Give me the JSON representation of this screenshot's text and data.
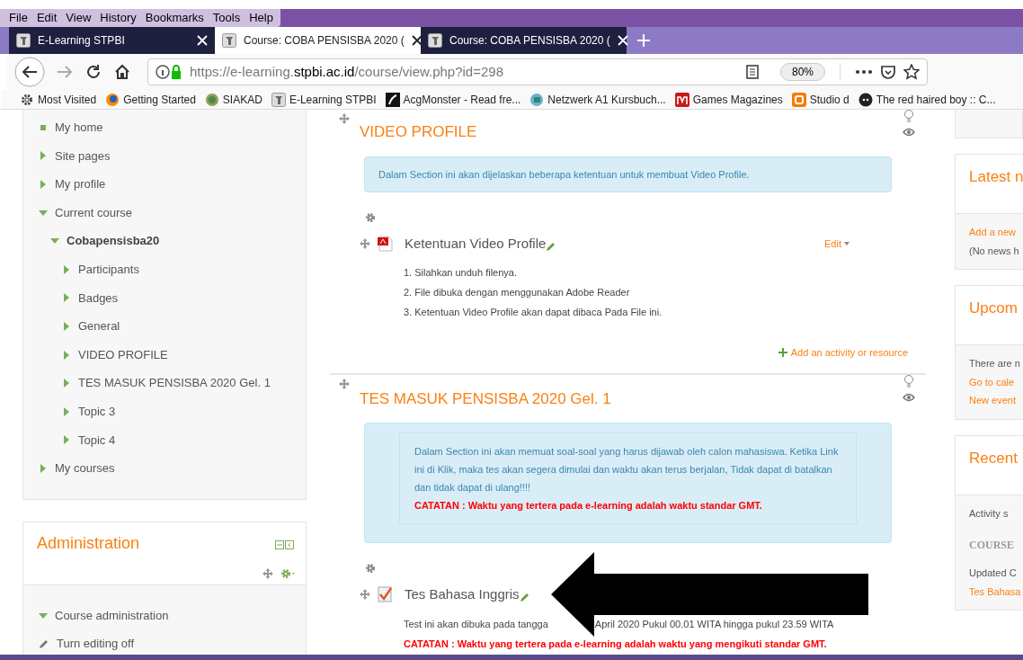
{
  "menu_bar": [
    "File",
    "Edit",
    "View",
    "History",
    "Bookmarks",
    "Tools",
    "Help"
  ],
  "tabs": [
    {
      "label": "E-Learning STPBI",
      "selected": false
    },
    {
      "label": "Course: COBA PENSISBA 2020 (",
      "selected": true
    },
    {
      "label": "Course: COBA PENSISBA 2020 (",
      "selected": false
    }
  ],
  "address_bar": {
    "url_start": "https://e-learning.",
    "url_domain": "stpbi.ac.id",
    "url_end": "/course/view.php?id=298",
    "zoom": "80%"
  },
  "bookmarks": [
    "Most Visited",
    "Getting Started",
    "SIAKAD",
    "E-Learning STPBI",
    "AcgMonster - Read fre...",
    "Netzwerk A1 Kursbuch...",
    "Games Magazines",
    "Studio d",
    "The red haired boy :: C..."
  ],
  "navigation": [
    {
      "label": "My home",
      "kind": "leaf"
    },
    {
      "label": "Site pages",
      "kind": "branch",
      "expanded": false
    },
    {
      "label": "My profile",
      "kind": "branch",
      "expanded": false
    },
    {
      "label": "Current course",
      "kind": "branch",
      "expanded": true,
      "children": [
        {
          "label": "Cobapensisba20",
          "kind": "course",
          "expanded": true,
          "children": [
            {
              "label": "Participants",
              "kind": "branch",
              "expanded": false
            },
            {
              "label": "Badges",
              "kind": "branch",
              "expanded": false
            },
            {
              "label": "General",
              "kind": "branch",
              "expanded": false
            },
            {
              "label": "VIDEO PROFILE",
              "kind": "branch",
              "expanded": false
            },
            {
              "label": "TES MASUK PENSISBA 2020 Gel. 1",
              "kind": "branch",
              "expanded": false
            },
            {
              "label": "Topic 3",
              "kind": "branch",
              "expanded": false
            },
            {
              "label": "Topic 4",
              "kind": "branch",
              "expanded": false
            }
          ]
        }
      ]
    },
    {
      "label": "My courses",
      "kind": "branch",
      "expanded": false
    }
  ],
  "administration": {
    "title": "Administration",
    "items": [
      {
        "label": "Course administration",
        "kind": "branch",
        "expanded": true
      },
      {
        "label": "Turn editing off",
        "kind": "edit"
      }
    ]
  },
  "sections": [
    {
      "title": "VIDEO PROFILE",
      "summary": [
        "Dalam Section ini akan dijelaskan beberapa ketentuan untuk membuat Video Profile."
      ],
      "activity": {
        "name": "Ketentuan Video Profile",
        "kind": "pdf",
        "edit": "Edit",
        "description": [
          {
            "text": "1. Silahkan unduh filenya.",
            "kind": "normal"
          },
          {
            "text": "2. File dibuka dengan menggunakan Adobe Reader",
            "kind": "normal"
          },
          {
            "text": "3. Ketentuan Video Profile akan dapat dibaca Pada File ini.",
            "kind": "normal"
          }
        ]
      },
      "add_link": "Add an activity or resource"
    },
    {
      "title": "TES MASUK PENSISBA 2020 Gel. 1",
      "summary": [
        "Dalam Section ini akan memuat soal-soal yang harus dijawab oleh calon mahasiswa.  Ketika Link ini di Klik, maka tes akan segera dimulai dan waktu akan terus berjalan, Tidak dapat di batalkan dan tidak dapat di ulang!!!!"
      ],
      "summary_note": "CATATAN : Waktu yang tertera pada e-learning adalah waktu standar GMT.",
      "activity": {
        "name": "Tes Bahasa Inggris",
        "kind": "quiz",
        "description": [
          {
            "text": "Test ini akan dibuka pada tangga",
            "kind": "cut"
          },
          {
            "text": "April 2020 Pukul 00.01 WITA hingga pukul 23.59 WITA",
            "kind": "normal"
          },
          {
            "text": "CATATAN : Waktu yang tertera pada e-learning adalah waktu yang mengikuti standar GMT.",
            "kind": "note"
          }
        ]
      }
    }
  ],
  "right_blocks": [
    {
      "title": "Latest n",
      "lines": [
        {
          "text": "Add a new",
          "kind": "link"
        },
        {
          "text": "(No news h",
          "kind": "text"
        }
      ]
    },
    {
      "title": "Upcom",
      "lines": [
        {
          "text": "There are n",
          "kind": "text"
        },
        {
          "text": "Go to cale",
          "kind": "link"
        },
        {
          "text": "New event",
          "kind": "link"
        }
      ]
    },
    {
      "title": "Recent",
      "lines": [
        {
          "text": "Activity s",
          "kind": "text"
        },
        {
          "text": "COURSE",
          "kind": "heading"
        },
        {
          "text": "Updated C",
          "kind": "text"
        },
        {
          "text": "Tes Bahasa",
          "kind": "link"
        }
      ]
    }
  ]
}
